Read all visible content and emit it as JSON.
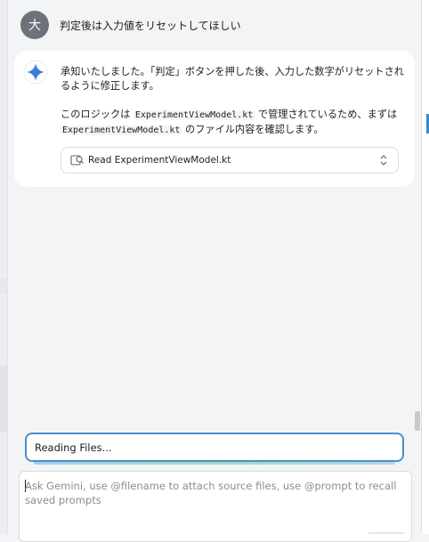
{
  "user_message": {
    "avatar_initial": "大",
    "text": "判定後は入力値をリセットしてほしい"
  },
  "assistant_message": {
    "icon": "gemini-sparkle-icon",
    "line1": "承知いたしました。「判定」ボタンを押した後、入力した数字がリセットされるように修正します。",
    "line2_prefix": "このロジックは ",
    "line2_code1": "ExperimentViewModel.kt",
    "line2_middle": " で管理されているため、まずは",
    "line2_code2": "ExperimentViewModel.kt",
    "line2_suffix": " のファイル内容を確認します。",
    "tool_call": {
      "icon": "file-search-icon",
      "label": "Read ExperimentViewModel.kt",
      "chevron": "chevron-up-down-icon"
    }
  },
  "status": {
    "text": "Reading Files..."
  },
  "input": {
    "placeholder": "Ask Gemini, use @filename to attach source files, use @prompt to recall saved prompts"
  },
  "colors": {
    "accent_blue": "#4a8fc8",
    "gemini_blue": "#3b7ddd",
    "avatar_bg": "#6c7279"
  }
}
